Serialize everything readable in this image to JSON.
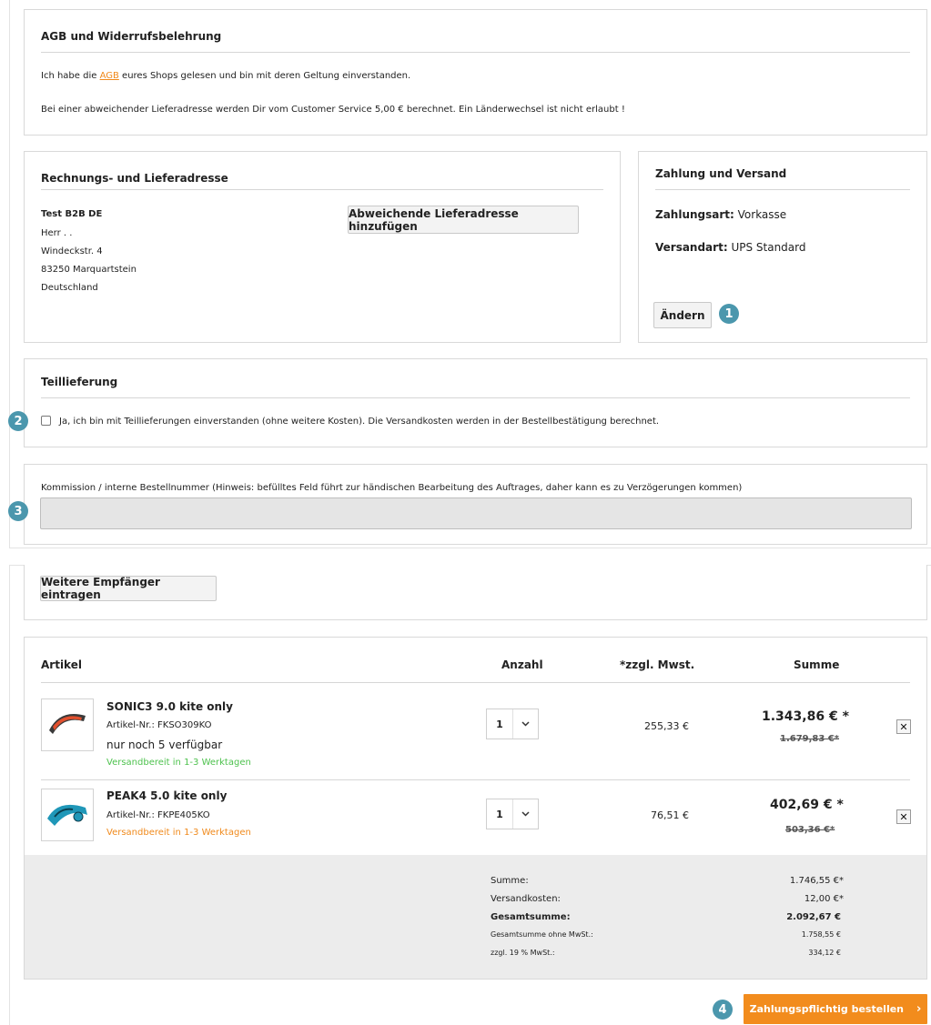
{
  "agb": {
    "title": "AGB und Widerrufsbelehrung",
    "line1_prefix": "Ich habe die ",
    "line1_link": "AGB",
    "line1_suffix": " eures Shops gelesen und bin mit deren Geltung einverstanden.",
    "line2": "Bei einer abweichender Lieferadresse werden Dir vom Customer Service 5,00 € berechnet. Ein Länderwechsel ist nicht erlaubt !"
  },
  "address": {
    "title": "Rechnungs- und Lieferadresse",
    "name": "Test B2B DE",
    "line1": "Herr . .",
    "line2": "Windeckstr. 4",
    "line3": "83250 Marquartstein",
    "line4": "Deutschland",
    "add_button": "Abweichende Lieferadresse hinzufügen"
  },
  "payment": {
    "title": "Zahlung und Versand",
    "method_label": "Zahlungsart:",
    "method_value": " Vorkasse",
    "shipping_label": "Versandart:",
    "shipping_value": " UPS Standard",
    "change_button": "Ändern"
  },
  "partial": {
    "title": "Teillieferung",
    "checkbox_label": "Ja, ich bin mit Teillieferungen einverstanden (ohne weitere Kosten). Die Versandkosten werden in der Bestellbestätigung berechnet.",
    "checked": false
  },
  "commission": {
    "label": "Kommission / interne Bestellnummer (Hinweis: befülltes Feld führt zur händischen Bearbeitung des Auftrages, daher kann es zu Verzögerungen kommen)",
    "value": ""
  },
  "recipients": {
    "button": "Weitere Empfänger eintragen"
  },
  "cart": {
    "headers": {
      "article": "Artikel",
      "qty": "Anzahl",
      "tax": "*zzgl. Mwst.",
      "sum": "Summe"
    },
    "items": [
      {
        "name": "SONIC3 9.0 kite only",
        "sku": "Artikel-Nr.: FKSO309KO",
        "stock": "nur noch 5 verfügbar",
        "delivery": "Versandbereit in 1-3 Werktagen",
        "qty": "1",
        "tax": "255,33 €",
        "price": "1.343,86 € *",
        "old_price": "1.679,83 €*"
      },
      {
        "name": "PEAK4 5.0 kite only",
        "sku": "Artikel-Nr.: FKPE405KO",
        "delivery": "Versandbereit in 1-3 Werktagen",
        "qty": "1",
        "tax": "76,51 €",
        "price": "402,69 € *",
        "old_price": "503,36 €*"
      }
    ],
    "remove_symbol": "✕"
  },
  "summary": {
    "sum_label": "Summe:",
    "sum_value": "1.746,55 €*",
    "shipping_label": "Versandkosten:",
    "shipping_value": "12,00 €*",
    "total_label": "Gesamtsumme:",
    "total_value": "2.092,67 €",
    "net_label": "Gesamtsumme ohne MwSt.:",
    "net_value": "1.758,55 €",
    "vat_label": "zzgl. 19 % MwSt.:",
    "vat_value": "334,12 €"
  },
  "order_button": "Zahlungspflichtig bestellen",
  "order_chevron": "›",
  "badges": [
    "1",
    "2",
    "3",
    "4"
  ],
  "colors": {
    "accent": "#f28c1d",
    "badge": "#4b97ad",
    "in_stock": "#4ec24e",
    "link": "#f08a1c"
  }
}
